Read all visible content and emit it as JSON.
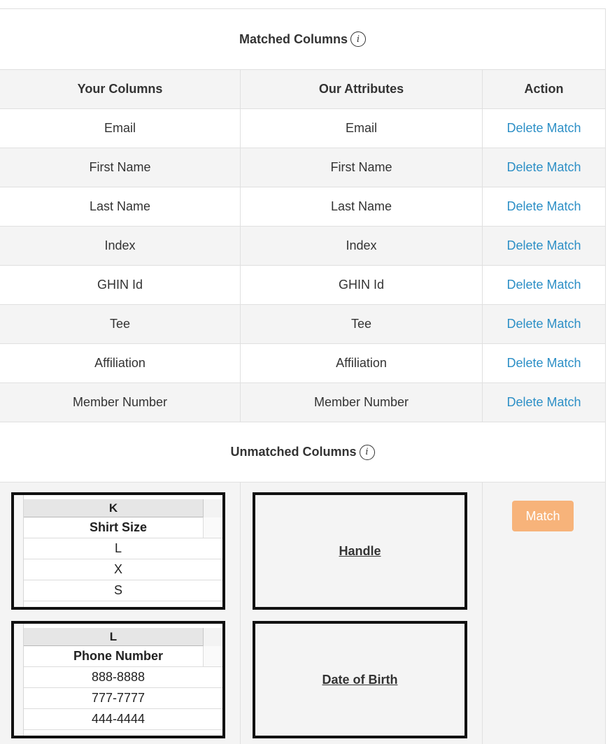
{
  "matched": {
    "title": "Matched Columns",
    "info_icon": "i",
    "headers": {
      "your_columns": "Your Columns",
      "our_attributes": "Our Attributes",
      "action": "Action"
    },
    "rows": [
      {
        "your": "Email",
        "ours": "Email",
        "action": "Delete Match"
      },
      {
        "your": "First Name",
        "ours": "First Name",
        "action": "Delete Match"
      },
      {
        "your": "Last Name",
        "ours": "Last Name",
        "action": "Delete Match"
      },
      {
        "your": "Index",
        "ours": "Index",
        "action": "Delete Match"
      },
      {
        "your": "GHIN Id",
        "ours": "GHIN Id",
        "action": "Delete Match"
      },
      {
        "your": "Tee",
        "ours": "Tee",
        "action": "Delete Match"
      },
      {
        "your": "Affiliation",
        "ours": "Affiliation",
        "action": "Delete Match"
      },
      {
        "your": "Member Number",
        "ours": "Member Number",
        "action": "Delete Match"
      }
    ]
  },
  "unmatched": {
    "title": "Unmatched Columns",
    "info_icon": "i",
    "sheets": [
      {
        "column_letter": "K",
        "header": "Shirt Size",
        "values": [
          "L",
          "X",
          "S"
        ]
      },
      {
        "column_letter": "L",
        "header": "Phone Number",
        "values": [
          "888-8888",
          "777-7777",
          "444-4444"
        ]
      }
    ],
    "targets": [
      {
        "label": "Handle"
      },
      {
        "label": "Date of Birth"
      }
    ],
    "match_button": "Match"
  },
  "colors": {
    "link": "#2c8fc6",
    "match_button": "#f7b37a",
    "row_alt": "#f4f4f4",
    "border": "#e0e0e0"
  }
}
